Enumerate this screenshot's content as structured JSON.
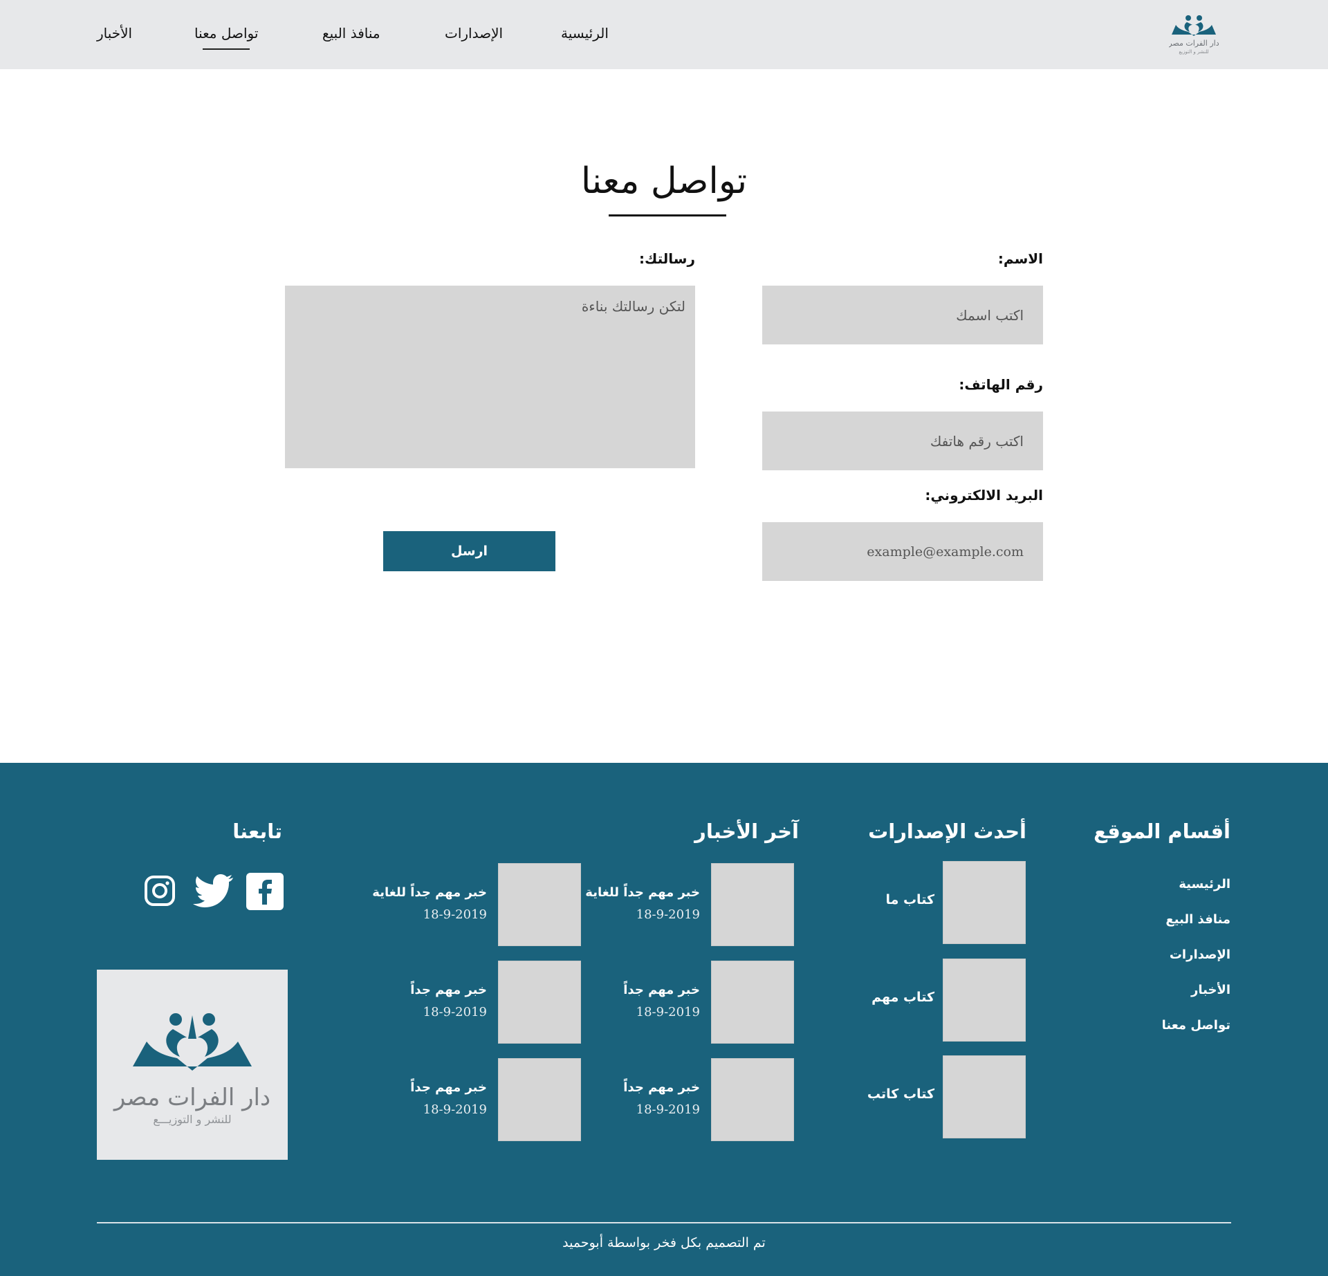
{
  "nav": {
    "items": [
      {
        "label": "الرئيسية"
      },
      {
        "label": "الإصدارات"
      },
      {
        "label": "منافذ البيع"
      },
      {
        "label": "تواصل معنا"
      },
      {
        "label": "الأخبار"
      }
    ],
    "logo": {
      "name": "دار الفرات مصر",
      "tagline": "للنشر و التوزيع"
    }
  },
  "contact": {
    "title": "تواصل معنا",
    "name_label": "الاسم:",
    "name_placeholder": "اكتب اسمك",
    "phone_label": "رقم الهاتف:",
    "phone_placeholder": "اكتب رقم هاتفك",
    "email_label": "البريد الالكتروني:",
    "email_placeholder": "example@example.com",
    "message_label": "رسالتك:",
    "message_placeholder": "لتكن رسالتك بناءة",
    "submit_label": "ارسل"
  },
  "footer": {
    "sections": {
      "title": "أقسام الموقع",
      "links": [
        "الرئيسية",
        "منافذ البيع",
        "الإصدارات",
        "الأخبار",
        "تواصل معنا"
      ]
    },
    "releases": {
      "title": "أحدث الإصدارات",
      "books": [
        {
          "title": "كتاب ما"
        },
        {
          "title": "كتاب مهم"
        },
        {
          "title": "كتاب كاتب"
        }
      ]
    },
    "news": {
      "title": "آخر الأخبار",
      "columns": [
        [
          {
            "title": "خبر مهم جداً للغاية",
            "date": "18-9-2019"
          },
          {
            "title": "خبر مهم جداً",
            "date": "18-9-2019"
          },
          {
            "title": "خبر مهم جداً",
            "date": "18-9-2019"
          }
        ],
        [
          {
            "title": "خبر مهم جداً للغاية",
            "date": "18-9-2019"
          },
          {
            "title": "خبر مهم جداً",
            "date": "18-9-2019"
          },
          {
            "title": "خبر مهم جداً",
            "date": "18-9-2019"
          }
        ]
      ]
    },
    "follow": {
      "title": "تابعنا",
      "icons": [
        "facebook-icon",
        "twitter-icon",
        "instagram-icon"
      ]
    },
    "logo": {
      "name": "دار الفرات مصر",
      "tagline": "للنشر و التوزيـــع"
    },
    "credit": "تم التصميم بكل فخر بواسطة أبوحميد"
  },
  "colors": {
    "brand": "#1a627c",
    "header_bg": "#e7e8ea",
    "input_bg": "#d6d6d6"
  }
}
